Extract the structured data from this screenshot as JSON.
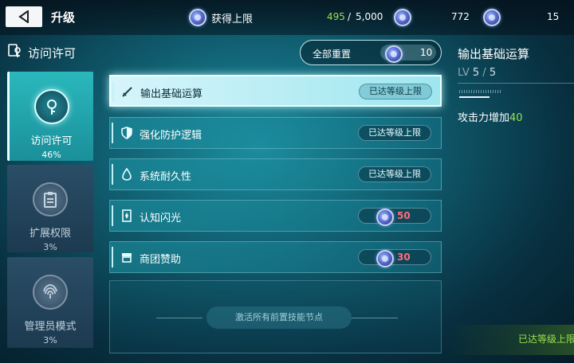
{
  "header": {
    "title": "升级",
    "cap_label": "获得上限",
    "cap_current": "495",
    "cap_separator": "/",
    "cap_max": "5,000",
    "resource1": "772",
    "resource2": "15"
  },
  "section": {
    "title": "访问许可"
  },
  "categories": [
    {
      "name": "访问许可",
      "percent": "46%"
    },
    {
      "name": "扩展权限",
      "percent": "3%"
    },
    {
      "name": "管理员模式",
      "percent": "3%"
    }
  ],
  "reset": {
    "label": "全部重置",
    "cost": "10"
  },
  "skills": [
    {
      "name": "输出基础运算",
      "status": "已达等级上限"
    },
    {
      "name": "强化防护逻辑",
      "status": "已达等级上限"
    },
    {
      "name": "系统耐久性",
      "status": "已达等级上限"
    },
    {
      "name": "认知闪光",
      "cost": "50"
    },
    {
      "name": "商团赞助",
      "cost": "30"
    }
  ],
  "locked_hint": "激活所有前置技能节点",
  "detail": {
    "title": "输出基础运算",
    "lv_label": "LV",
    "lv_current": "5",
    "lv_sep": "/",
    "lv_max": "5",
    "effect_label": "攻击力增加",
    "effect_value": "40",
    "status": "已达等级上限"
  }
}
